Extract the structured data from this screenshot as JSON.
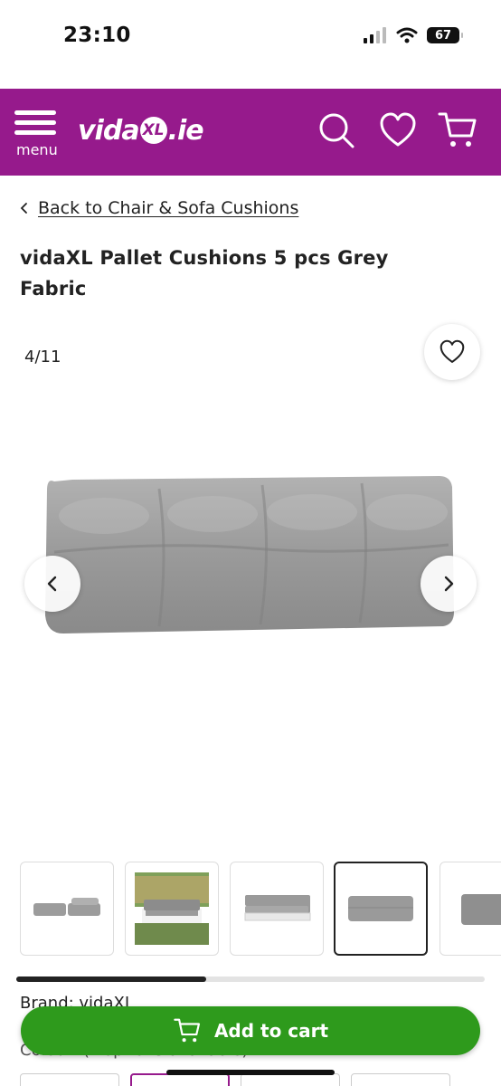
{
  "status_bar": {
    "time": "23:10",
    "battery": "67"
  },
  "header": {
    "menu_label": "menu",
    "logo_main": "vida",
    "logo_mark": "XL",
    "logo_suffix": ".ie"
  },
  "breadcrumb": {
    "label": "Back to Chair & Sofa Cushions"
  },
  "product": {
    "title": "vidaXL Pallet Cushions 5 pcs Grey Fabric"
  },
  "gallery": {
    "counter": "4/11"
  },
  "details": {
    "brand": "Brand: vidaXL",
    "colour": "Colour: (? options available)"
  },
  "cart": {
    "label": "Add to cart"
  },
  "colors": {
    "brand": "#961a8c",
    "cart": "#2e9a1c",
    "cushion": "#9a9a9a"
  }
}
